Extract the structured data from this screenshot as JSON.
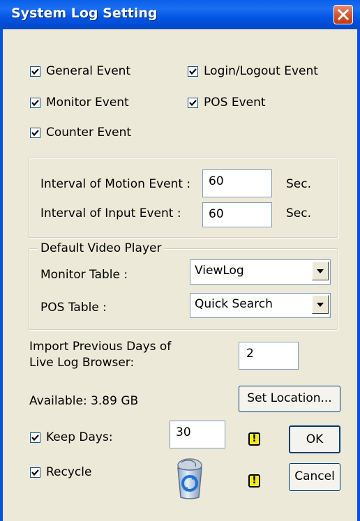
{
  "window": {
    "title": "System Log Setting",
    "close_icon": "close-icon"
  },
  "events": {
    "general": {
      "label": "General Event",
      "checked": true
    },
    "login_logout": {
      "label": "Login/Logout Event",
      "checked": true
    },
    "monitor": {
      "label": "Monitor Event",
      "checked": true
    },
    "pos": {
      "label": "POS Event",
      "checked": true
    },
    "counter": {
      "label": "Counter Event",
      "checked": true
    }
  },
  "intervals": {
    "motion_label": "Interval of Motion Event :",
    "motion_value": "60",
    "input_label": "Interval of Input Event :",
    "input_value": "60",
    "unit": "Sec."
  },
  "video_player": {
    "legend": "Default Video Player",
    "monitor_label": "Monitor Table :",
    "monitor_value": "ViewLog",
    "pos_label": "POS Table :",
    "pos_value": "Quick Search"
  },
  "import": {
    "label_line1": "Import Previous Days of",
    "label_line2": "Live Log Browser:",
    "value": "2"
  },
  "storage": {
    "available": "Available: 3.89 GB",
    "set_location_label": "Set Location..."
  },
  "keep_days": {
    "label": "Keep Days:",
    "checked": true,
    "value": "30"
  },
  "recycle": {
    "label": "Recycle",
    "checked": true
  },
  "warning_glyph": "!",
  "buttons": {
    "ok": "OK",
    "cancel": "Cancel"
  },
  "colors": {
    "titlebar": "#0054E3",
    "dialog_bg": "#ECE9D8",
    "warning": "#F3EC1A"
  }
}
